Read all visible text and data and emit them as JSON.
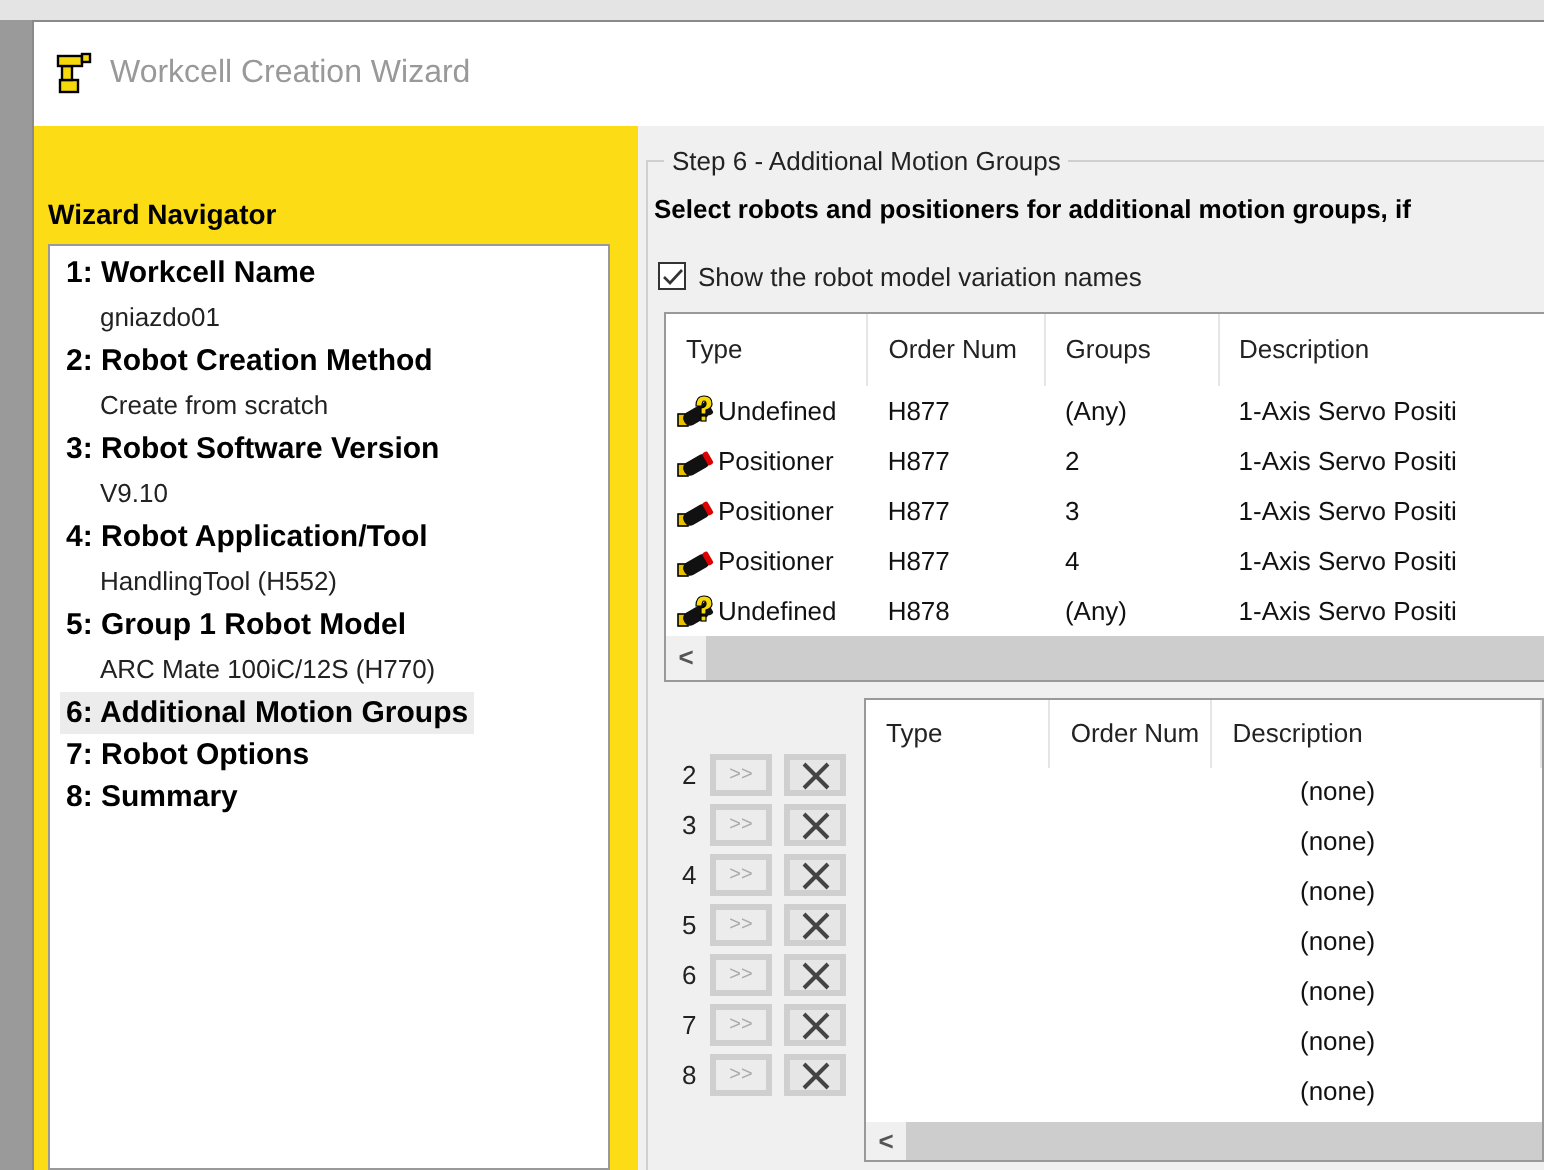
{
  "window": {
    "title": "Workcell Creation Wizard"
  },
  "navigator": {
    "title": "Wizard Navigator",
    "items": [
      {
        "label": "1: Workcell Name",
        "value": "gniazdo01",
        "selected": false
      },
      {
        "label": "2: Robot Creation Method",
        "value": "Create from scratch",
        "selected": false
      },
      {
        "label": "3: Robot Software Version",
        "value": "V9.10",
        "selected": false
      },
      {
        "label": "4: Robot Application/Tool",
        "value": "HandlingTool (H552)",
        "selected": false
      },
      {
        "label": "5: Group 1 Robot Model",
        "value": "ARC Mate 100iC/12S (H770)",
        "selected": false
      },
      {
        "label": "6: Additional Motion Groups",
        "selected": true
      },
      {
        "label": "7: Robot Options",
        "selected": false
      },
      {
        "label": "8: Summary",
        "selected": false
      }
    ]
  },
  "step": {
    "title": "Step 6 - Additional Motion Groups",
    "instruction": "Select robots and positioners for additional motion groups, if",
    "checkbox": {
      "label": "Show the robot model variation names",
      "checked": true
    }
  },
  "available_table": {
    "columns": [
      "Type",
      "Order Num",
      "Groups",
      "Description"
    ],
    "rows": [
      {
        "kind": "undefined",
        "type": "Undefined",
        "order_num": "H877",
        "groups": "(Any)",
        "description": "1-Axis Servo Positi"
      },
      {
        "kind": "positioner",
        "type": "Positioner",
        "order_num": "H877",
        "groups": "2",
        "description": "1-Axis Servo Positi"
      },
      {
        "kind": "positioner",
        "type": "Positioner",
        "order_num": "H877",
        "groups": "3",
        "description": "1-Axis Servo Positi"
      },
      {
        "kind": "positioner",
        "type": "Positioner",
        "order_num": "H877",
        "groups": "4",
        "description": "1-Axis Servo Positi"
      },
      {
        "kind": "undefined",
        "type": "Undefined",
        "order_num": "H878",
        "groups": "(Any)",
        "description": "1-Axis Servo Positi"
      }
    ],
    "scroll_left": "<"
  },
  "groups": {
    "add_label": ">>",
    "slots": [
      {
        "number": "2",
        "description": "(none)",
        "disabled": true
      },
      {
        "number": "3",
        "description": "(none)",
        "disabled": true
      },
      {
        "number": "4",
        "description": "(none)",
        "disabled": true
      },
      {
        "number": "5",
        "description": "(none)",
        "disabled": true
      },
      {
        "number": "6",
        "description": "(none)",
        "disabled": true
      },
      {
        "number": "7",
        "description": "(none)",
        "disabled": true
      },
      {
        "number": "8",
        "description": "(none)",
        "disabled": true
      }
    ]
  },
  "selected_table": {
    "columns": [
      "Type",
      "Order Num",
      "Description"
    ],
    "scroll_left": "<"
  }
}
